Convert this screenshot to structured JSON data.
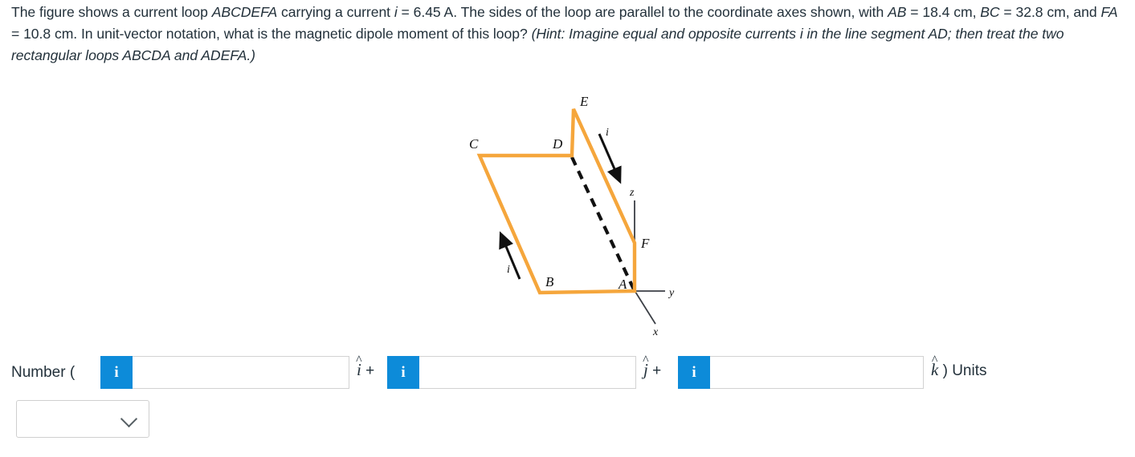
{
  "question": {
    "line1_a": "The figure shows a current loop ",
    "line1_loop": "ABCDEFA",
    "line1_b": " carrying a current ",
    "line1_i": "i",
    "line1_c": " = 6.45 A. The sides of the loop are parallel to the coordinate axes shown,",
    "line2_a": "with ",
    "line2_ab": "AB",
    "line2_b": " = 18.4 cm, ",
    "line2_bc": "BC",
    "line2_c": " = 32.8 cm, and ",
    "line2_fa": "FA",
    "line2_d": " = 10.8 cm. In unit-vector notation, what is the magnetic dipole moment of this loop? ",
    "line2_hint": "(Hint:",
    "line3_hint": "Imagine equal and opposite currents i in the line segment AD; then treat the two rectangular loops ABCDA and ADEFA.)",
    "current_value": "6.45",
    "current_unit": "A",
    "AB": "18.4 cm",
    "BC": "32.8 cm",
    "FA": "10.8 cm"
  },
  "figure": {
    "vertex_labels": {
      "A": "A",
      "B": "B",
      "C": "C",
      "D": "D",
      "E": "E",
      "F": "F"
    },
    "axis_labels": {
      "x": "x",
      "y": "y",
      "z": "z"
    },
    "current_label_left": "i",
    "current_label_right": "i",
    "loop_color": "#f5a63c",
    "dashed_color": "#111111",
    "axis_color": "#3b3f46"
  },
  "answer": {
    "number_label": "Number (",
    "info_label": "i",
    "field_i_value": "",
    "field_j_value": "",
    "field_k_value": "",
    "plus_1": "+",
    "plus_2": "+",
    "vec_i": "i",
    "vec_j": "j",
    "vec_k": "k",
    "hat": "^",
    "close_units": ") Units",
    "units_selected": ""
  },
  "colors": {
    "accent_blue": "#0d8bd9",
    "loop_orange": "#f5a63c",
    "text": "#23313b"
  }
}
